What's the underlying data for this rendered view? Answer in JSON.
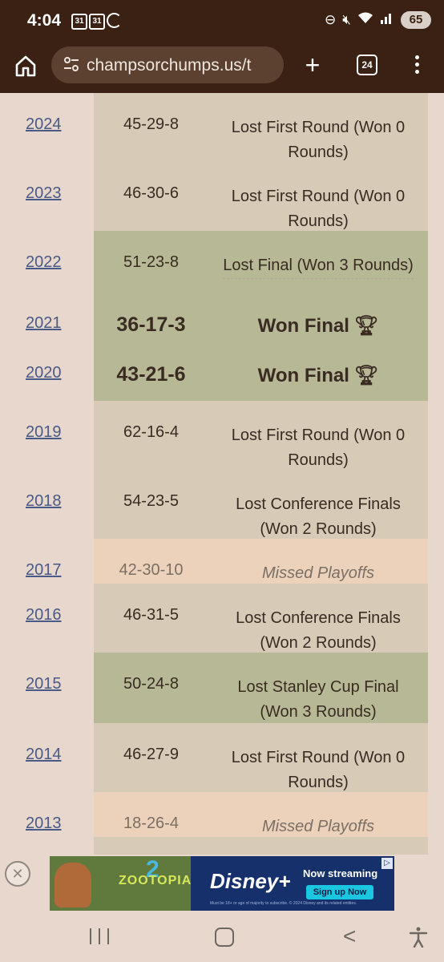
{
  "status_bar": {
    "time": "4:04",
    "calendar_badges": [
      "31",
      "31"
    ],
    "battery": "65"
  },
  "browser": {
    "url": "champsorchumps.us/t",
    "tab_count": "24"
  },
  "seasons": [
    {
      "year": "2024",
      "record": "45-29-8",
      "result": "Lost First Round (Won 0 Rounds)",
      "style": "beige"
    },
    {
      "year": "2023",
      "record": "46-30-6",
      "result": "Lost First Round (Won 0 Rounds)",
      "style": "beige"
    },
    {
      "year": "2022",
      "record": "51-23-8",
      "result": "Lost Final (Won 3 Rounds)",
      "style": "green"
    },
    {
      "year": "2021",
      "record": "36-17-3",
      "result": "Won Final",
      "style": "won"
    },
    {
      "year": "2020",
      "record": "43-21-6",
      "result": "Won Final",
      "style": "won"
    },
    {
      "year": "2019",
      "record": "62-16-4",
      "result": "Lost First Round (Won 0 Rounds)",
      "style": "beige"
    },
    {
      "year": "2018",
      "record": "54-23-5",
      "result": "Lost Conference Finals (Won 2 Rounds)",
      "style": "beige"
    },
    {
      "year": "2017",
      "record": "42-30-10",
      "result": "Missed Playoffs",
      "style": "peach"
    },
    {
      "year": "2016",
      "record": "46-31-5",
      "result": "Lost Conference Finals (Won 2 Rounds)",
      "style": "beige"
    },
    {
      "year": "2015",
      "record": "50-24-8",
      "result": "Lost Stanley Cup Final (Won 3 Rounds)",
      "style": "green"
    },
    {
      "year": "2014",
      "record": "46-27-9",
      "result": "Lost First Round (Won 0 Rounds)",
      "style": "beige"
    },
    {
      "year": "2013",
      "record": "18-26-4",
      "result": "Missed Playoffs",
      "style": "peach"
    }
  ],
  "ad": {
    "close": "✕",
    "movie": "ZOOTOPIA",
    "sequel": "2",
    "brand": "Disney+",
    "headline": "Now streaming",
    "cta": "Sign up Now",
    "fine_print": "Must be 18+ or age of majority to subscribe. © 2024 Disney and its related entities."
  }
}
